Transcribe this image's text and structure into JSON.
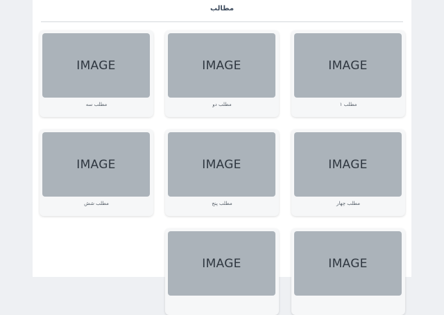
{
  "header": {
    "title": "مطالب"
  },
  "cards": [
    {
      "image_text": "IMAGE",
      "caption": "مطلب ۱"
    },
    {
      "image_text": "IMAGE",
      "caption": "مطلب دو"
    },
    {
      "image_text": "IMAGE",
      "caption": "مطلب سه"
    },
    {
      "image_text": "IMAGE",
      "caption": "مطلب چهار"
    },
    {
      "image_text": "IMAGE",
      "caption": "مطلب پنج"
    },
    {
      "image_text": "IMAGE",
      "caption": "مطلب شش"
    },
    {
      "image_text": "IMAGE",
      "caption": ""
    },
    {
      "image_text": "IMAGE",
      "caption": ""
    }
  ]
}
